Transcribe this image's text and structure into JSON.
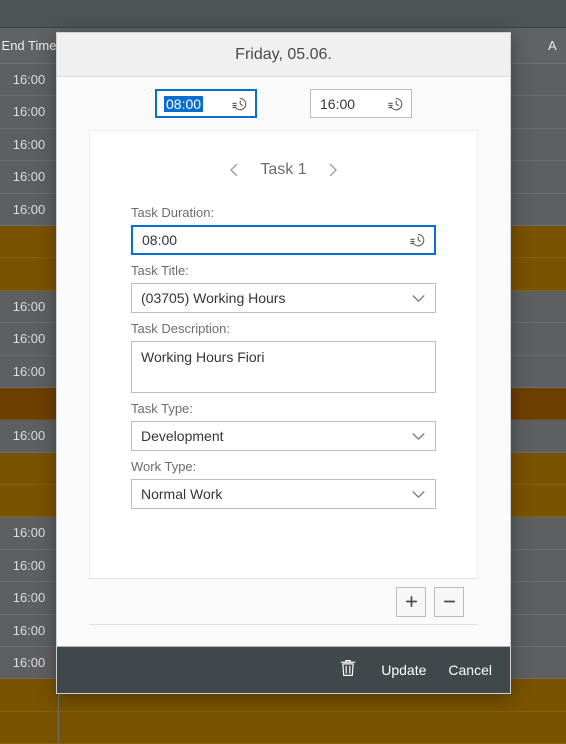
{
  "background": {
    "header": {
      "end_time_label": "End Time",
      "partial_right_label": "A"
    },
    "time_cell_value": "16:00",
    "rows": [
      {
        "type": "gray",
        "time": "16:00"
      },
      {
        "type": "gray",
        "time": "16:00"
      },
      {
        "type": "gray",
        "time": "16:00"
      },
      {
        "type": "gray",
        "time": "16:00"
      },
      {
        "type": "gray",
        "time": "16:00"
      },
      {
        "type": "amber",
        "time": ""
      },
      {
        "type": "amber",
        "time": ""
      },
      {
        "type": "gray",
        "time": "16:00"
      },
      {
        "type": "gray",
        "time": "16:00"
      },
      {
        "type": "gray",
        "time": "16:00"
      },
      {
        "type": "amber2",
        "time": ""
      },
      {
        "type": "gray",
        "time": "16:00"
      },
      {
        "type": "amber",
        "time": ""
      },
      {
        "type": "amber",
        "time": ""
      },
      {
        "type": "gray",
        "time": "16:00"
      },
      {
        "type": "gray",
        "time": "16:00"
      },
      {
        "type": "gray",
        "time": "16:00"
      },
      {
        "type": "gray",
        "time": "16:00"
      },
      {
        "type": "gray",
        "time": "16:00"
      },
      {
        "type": "amber",
        "time": ""
      },
      {
        "type": "amber",
        "time": ""
      }
    ]
  },
  "dialog": {
    "title": "Friday, 05.06.",
    "time_range": {
      "start": {
        "value": "08:00",
        "icon": "clock-history-icon",
        "focused": true
      },
      "end": {
        "value": "16:00",
        "icon": "clock-history-icon",
        "focused": false
      }
    },
    "task_nav": {
      "prev_icon": "chevron-left-icon",
      "label": "Task 1",
      "next_icon": "chevron-right-icon"
    },
    "fields": [
      {
        "key": "task_duration",
        "label": "Task Duration:",
        "value": "08:00",
        "control": "time-input",
        "icon": "clock-history-icon",
        "focused": true
      },
      {
        "key": "task_title",
        "label": "Task Title:",
        "value": "(03705) Working Hours",
        "control": "select",
        "icon": "chevron-down-icon",
        "focused": false
      },
      {
        "key": "task_description",
        "label": "Task Description:",
        "value": "Working Hours Fiori",
        "control": "textarea",
        "icon": "",
        "focused": false
      },
      {
        "key": "task_type",
        "label": "Task Type:",
        "value": "Development",
        "control": "select",
        "icon": "chevron-down-icon",
        "focused": false
      },
      {
        "key": "work_type",
        "label": "Work Type:",
        "value": "Normal Work",
        "control": "select",
        "icon": "chevron-down-icon",
        "focused": false
      }
    ],
    "row_actions": {
      "add_label": "+",
      "add_icon": "plus-icon",
      "remove_label": "−",
      "remove_icon": "minus-icon"
    },
    "footer": {
      "delete_icon": "trash-icon",
      "update_label": "Update",
      "cancel_label": "Cancel"
    }
  },
  "colors": {
    "accent": "#0a6ed1",
    "footer_bg": "#3f484b",
    "amber_row": "#7a5300",
    "amber_row_alt": "#6f3f02",
    "gray_row": "#5d5f61"
  }
}
